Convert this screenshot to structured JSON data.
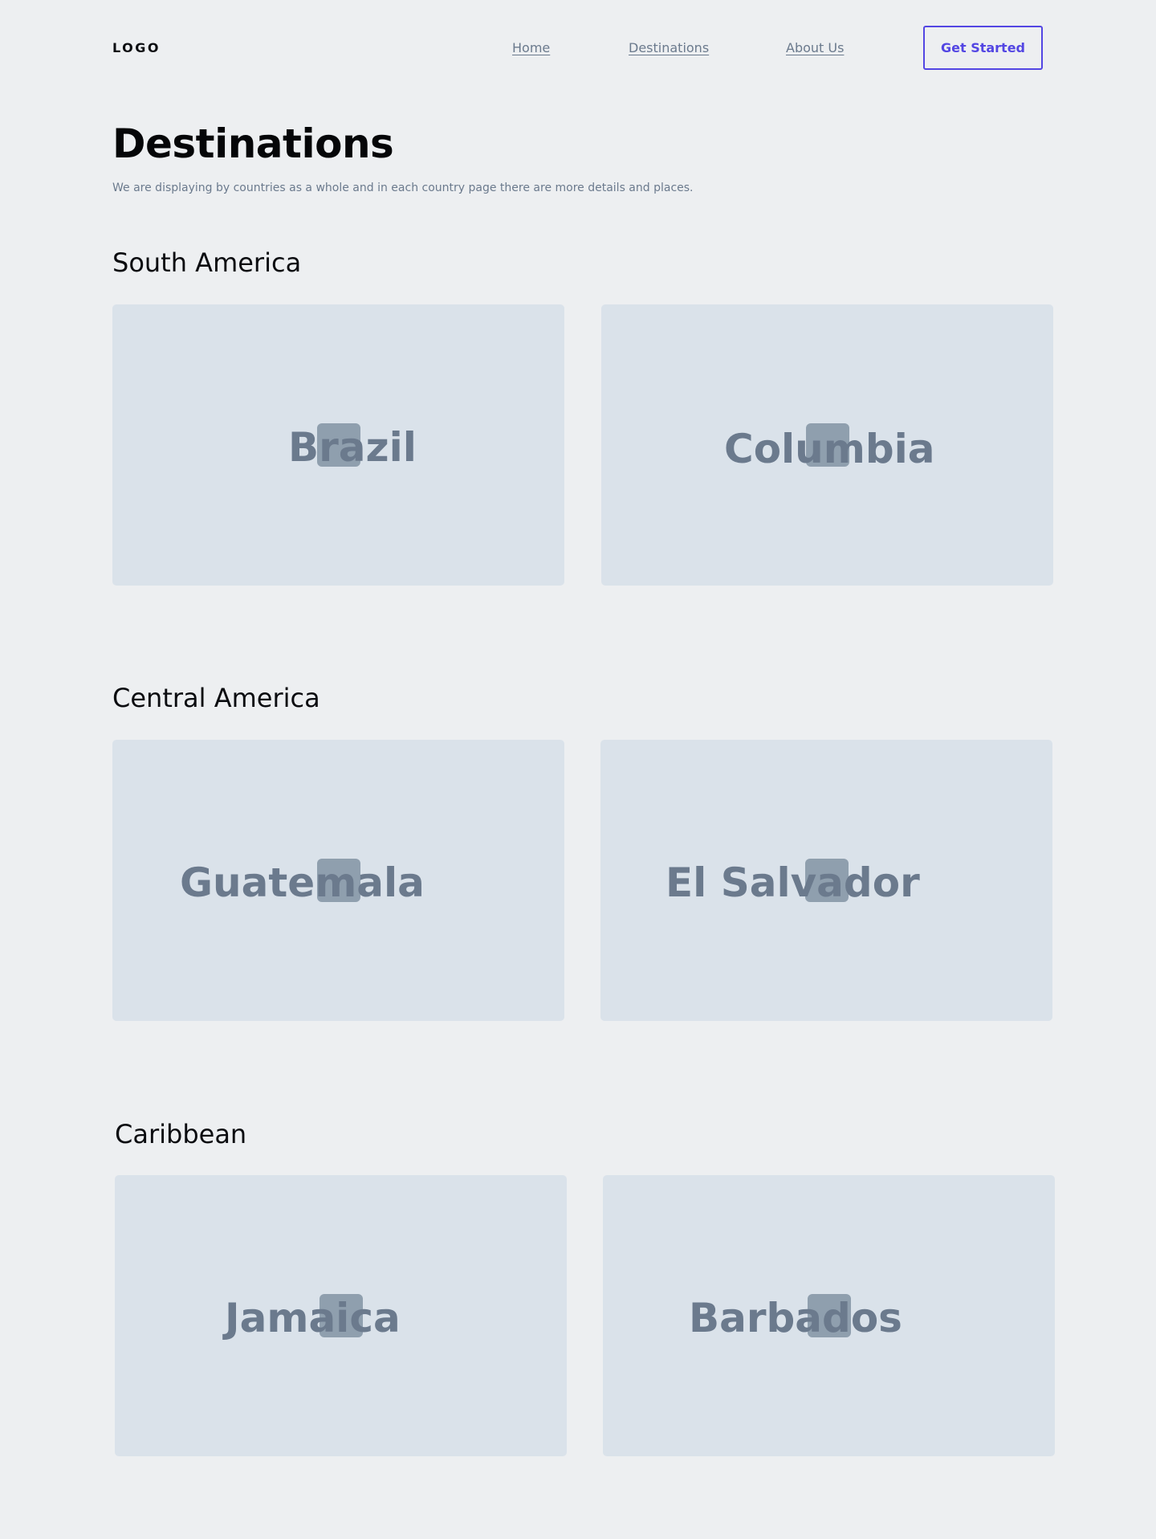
{
  "nav": {
    "logo": "LOGO",
    "links": [
      "Home",
      "Destinations",
      "About Us"
    ],
    "cta": "Get Started"
  },
  "page": {
    "title": "Destinations",
    "subtitle": "We are displaying by countries as a whole and in each country page there are more details and places."
  },
  "colors": {
    "background": "#edeff1",
    "card": "#dae2ea",
    "card_text": "#6b7a8d",
    "thumb": "#8f9fae",
    "accent": "#5346e3"
  },
  "regions": [
    {
      "name": "South America",
      "countries": [
        "Brazil",
        "Columbia"
      ]
    },
    {
      "name": "Central America",
      "countries": [
        "Guatemala",
        "El Salvador"
      ]
    },
    {
      "name": "Caribbean",
      "countries": [
        "Jamaica",
        "Barbados"
      ]
    }
  ]
}
